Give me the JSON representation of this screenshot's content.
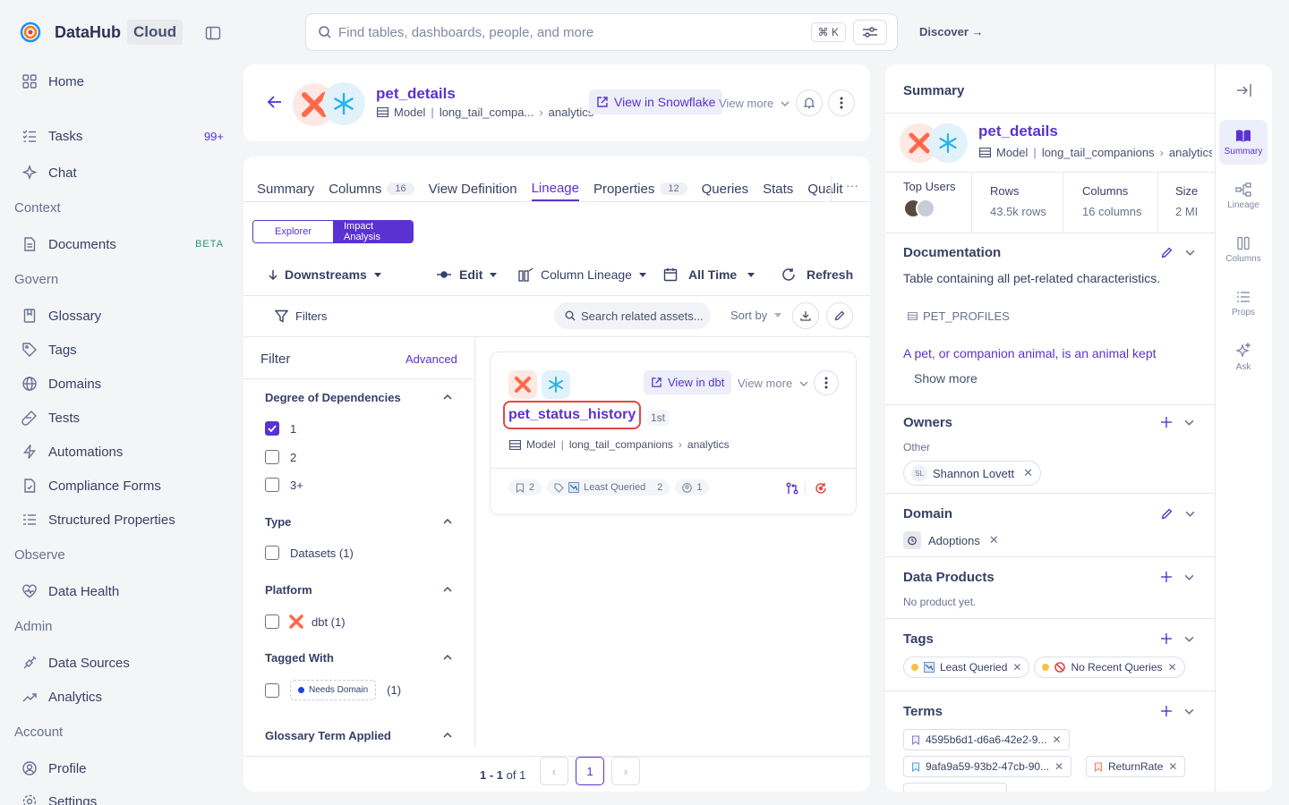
{
  "brand": {
    "name": "DataHub",
    "tag": "Cloud"
  },
  "nav": {
    "home": "Home",
    "tasks": "Tasks",
    "tasks_badge": "99+",
    "chat": "Chat",
    "context_h": "Context",
    "documents": "Documents",
    "documents_badge": "BETA",
    "govern_h": "Govern",
    "glossary": "Glossary",
    "tags": "Tags",
    "domains": "Domains",
    "tests": "Tests",
    "automations": "Automations",
    "compliance": "Compliance Forms",
    "structured": "Structured Properties",
    "observe_h": "Observe",
    "data_health": "Data Health",
    "admin_h": "Admin",
    "data_sources": "Data Sources",
    "analytics": "Analytics",
    "account_h": "Account",
    "profile": "Profile",
    "settings": "Settings"
  },
  "search": {
    "placeholder": "Find tables, dashboards, people, and more",
    "shortcut": "⌘ K"
  },
  "discover": "Discover →",
  "entity": {
    "name": "pet_details",
    "type": "Model",
    "path1": "long_tail_compa...",
    "path2": "analytics",
    "view_btn": "View in Snowflake",
    "view_more": "View more"
  },
  "tabs": [
    {
      "label": "Summary",
      "count": ""
    },
    {
      "label": "Columns",
      "count": "16"
    },
    {
      "label": "View Definition",
      "count": ""
    },
    {
      "label": "Lineage",
      "count": ""
    },
    {
      "label": "Properties",
      "count": "12"
    },
    {
      "label": "Queries",
      "count": ""
    },
    {
      "label": "Stats",
      "count": ""
    },
    {
      "label": "Qualit",
      "count": ""
    }
  ],
  "more_tabs": "···",
  "lineage": {
    "explorer": "Explorer",
    "impact": "Impact Analysis",
    "direction": "Downstreams",
    "edit": "Edit",
    "column_lineage": "Column Lineage",
    "time": "All Time",
    "refresh": "Refresh",
    "filters": "Filters",
    "search_related": "Search related assets...",
    "sort_by": "Sort by"
  },
  "filter_panel": {
    "title": "Filter",
    "advanced": "Advanced",
    "degree_h": "Degree of Dependencies",
    "degree_opts": [
      "1",
      "2",
      "3+"
    ],
    "type_h": "Type",
    "type_opt": "Datasets (1)",
    "platform_h": "Platform",
    "platform_opt": "dbt (1)",
    "tagged_h": "Tagged With",
    "tag_opt": "Needs Domain",
    "tag_count": "(1)",
    "glossary_h": "Glossary Term Applied"
  },
  "result": {
    "view_btn": "View in dbt",
    "view_more": "View more",
    "name": "pet_status_history",
    "degree": "1st",
    "type": "Model",
    "path1": "long_tail_companions",
    "path2": "analytics",
    "terms_count": "2",
    "tag_name": "Least Queried",
    "tag_count": "2",
    "owners_count": "1"
  },
  "pager": {
    "range": "1 - 1",
    "of": "of 1",
    "page": "1"
  },
  "summary": {
    "title": "Summary",
    "name": "pet_details",
    "type": "Model",
    "path1": "long_tail_companions",
    "path2": "analytics",
    "top_users": "Top Users",
    "rows_lbl": "Rows",
    "rows_val": "43.5k rows",
    "cols_lbl": "Columns",
    "cols_val": "16 columns",
    "size_lbl": "Size",
    "size_val": "2 MI",
    "doc_h": "Documentation",
    "doc_text": "Table containing all pet-related characteristics.",
    "doc_ref": "PET_PROFILES",
    "doc_link": "A pet, or companion animal, is an animal kept",
    "show_more": "Show more",
    "owners_h": "Owners",
    "owners_sub": "Other",
    "owner_initials": "SL",
    "owner_name": "Shannon Lovett",
    "domain_h": "Domain",
    "domain_name": "Adoptions",
    "dp_h": "Data Products",
    "dp_empty": "No product yet.",
    "tags_h": "Tags",
    "tag1": "Least Queried",
    "tag2": "No Recent Queries",
    "terms_h": "Terms",
    "term1": "4595b6d1-d6a6-42e2-9...",
    "term2": "9afa9a59-93b2-47cb-90...",
    "term3": "ReturnRate"
  },
  "rail": {
    "summary": "Summary",
    "lineage": "Lineage",
    "columns": "Columns",
    "props": "Props",
    "ask": "Ask"
  },
  "colors": {
    "accent": "#5a32d1",
    "dbt": "#ff694a",
    "snowflake": "#29b5e8"
  }
}
